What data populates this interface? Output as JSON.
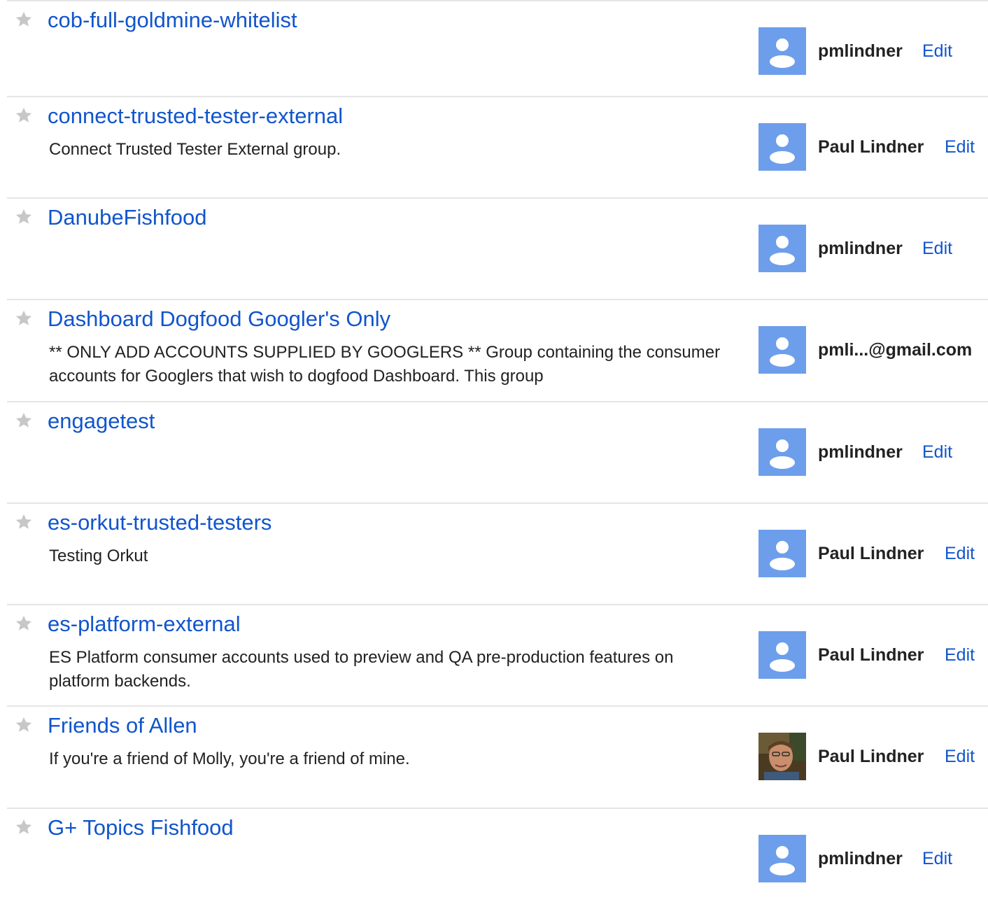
{
  "groups": [
    {
      "name": "cob-full-goldmine-whitelist",
      "description": "",
      "owner": "pmlindner",
      "edit": "Edit",
      "avatar": "default-avatar-icon"
    },
    {
      "name": "connect-trusted-tester-external",
      "description": "Connect Trusted Tester External group.",
      "owner": "Paul Lindner",
      "edit": "Edit",
      "avatar": "default-avatar-icon"
    },
    {
      "name": "DanubeFishfood",
      "description": "",
      "owner": "pmlindner",
      "edit": "Edit",
      "avatar": "default-avatar-icon"
    },
    {
      "name": "Dashboard Dogfood Googler's Only",
      "description": "** ONLY ADD ACCOUNTS SUPPLIED BY GOOGLERS ** Group containing the consumer accounts for Googlers that wish to dogfood Dashboard. This group",
      "owner": "pmli...@gmail.com",
      "edit": "",
      "avatar": "default-avatar-icon"
    },
    {
      "name": "engagetest",
      "description": "",
      "owner": "pmlindner",
      "edit": "Edit",
      "avatar": "default-avatar-icon"
    },
    {
      "name": "es-orkut-trusted-testers",
      "description": "Testing Orkut",
      "owner": "Paul Lindner",
      "edit": "Edit",
      "avatar": "default-avatar-icon"
    },
    {
      "name": "es-platform-external",
      "description": "ES Platform consumer accounts used to preview and QA pre-production features on platform backends.",
      "owner": "Paul Lindner",
      "edit": "Edit",
      "avatar": "default-avatar-icon"
    },
    {
      "name": "Friends of Allen",
      "description": "If you're a friend of Molly, you're a friend of mine.",
      "owner": "Paul Lindner",
      "edit": "Edit",
      "avatar": "user-photo-avatar"
    },
    {
      "name": "G+ Topics Fishfood",
      "description": "",
      "owner": "pmlindner",
      "edit": "Edit",
      "avatar": "default-avatar-icon"
    }
  ],
  "colors": {
    "link": "#1155cc",
    "avatar_bg": "#6d9eeb",
    "divider": "#e5e5e5",
    "star": "#c7c7c7"
  }
}
